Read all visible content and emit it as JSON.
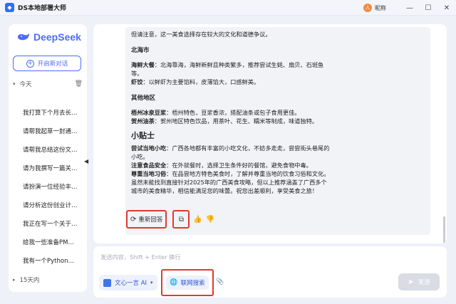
{
  "window": {
    "title": "DS本地部署大师",
    "user_name": "昵称",
    "user_avatar_char": "人",
    "minimize": "—",
    "maximize": "☐",
    "close": "✕"
  },
  "sidebar": {
    "brand": "DeepSeek",
    "new_chat_label": "开启新对话",
    "today_label": "今天",
    "older_label": "15天内",
    "history": [
      "我打算下个月去长…",
      "请帮我起草一封通…",
      "请帮我总结这份文…",
      "请为我撰写一篇关…",
      "请扮演一位经验丰…",
      "请分析这份创业计…",
      "我正在写一个关于…",
      "给我一些准备PM…",
      "我有一个Python…"
    ]
  },
  "answer": {
    "intro": "但请注意，这一美食选择存在较大的文化和道德争议。",
    "beihai_title": "北海市",
    "beihai_1_key": "海鲜大餐",
    "beihai_1_text": "：北海靠海，海鲜新鲜且种类繁多，推荐尝试生蚝、扇贝、石斑鱼",
    "beihai_1_cont": "等。",
    "beihai_2_key": "虾饺",
    "beihai_2_text": "：以鲜虾为主要馅料，皮薄馅大，口感鲜美。",
    "other_title": "其他地区",
    "other_1_key": "梧州冰泉豆浆",
    "other_1_text": "：梧州特色，豆浆香浓，搭配油条或包子食用更佳。",
    "other_2_key": "贺州油茶",
    "other_2_text": "：贺州地区特色饮品，用茶叶、花生、糯米等制成，味道独特。",
    "tips_title": "小贴士",
    "tip_1_key": "尝试当地小吃",
    "tip_1_text": "：广西各地都有丰富的小吃文化，不妨多走走，尝尝街头巷尾的",
    "tip_1_cont": "小吃。",
    "tip_2_key": "注意食品安全",
    "tip_2_text": "：在外就餐时，选择卫生条件好的餐馆，避免食物中毒。",
    "tip_3_key": "尊重当地习俗",
    "tip_3_text": "：在品尝地方特色美食时，了解并尊重当地的饮食习俗和文化。",
    "closing_1": "虽然未能找到直接针对2025年的广西美食攻略，但以上推荐涵盖了广西多个",
    "closing_2": "城市的美食精华，相信能满足您的味蕾。祝您出差顺利，享受美食之旅！"
  },
  "actions": {
    "regenerate_label": "重新回答"
  },
  "input": {
    "placeholder": "发送内容，Shift + Enter 换行",
    "model_label": "文心一言 AI",
    "web_search_label": "联网搜索",
    "send_label": "发送"
  }
}
